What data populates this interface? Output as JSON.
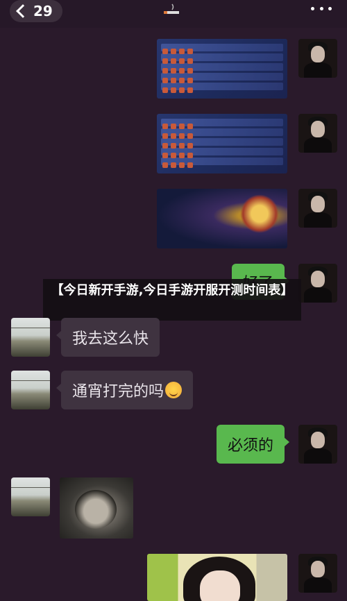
{
  "header": {
    "unread_count": "29",
    "back_icon": "chevron-left-icon",
    "more_icon": "more-dots-icon"
  },
  "banner": {
    "text": "【今日新开手游,今日手游开服开测时间表】"
  },
  "messages": [
    {
      "sender": "me",
      "type": "image",
      "description_icon": "game-ranking-screenshot"
    },
    {
      "sender": "me",
      "type": "image",
      "description_icon": "game-ranking-screenshot"
    },
    {
      "sender": "me",
      "type": "image",
      "description_icon": "game-hero-screenshot"
    },
    {
      "sender": "me",
      "type": "text",
      "text": "好了"
    },
    {
      "sender": "them",
      "type": "text",
      "text": "我去这么快"
    },
    {
      "sender": "them",
      "type": "text",
      "text": "通宵打完的吗"
    },
    {
      "sender": "me",
      "type": "text",
      "text": "必须的"
    },
    {
      "sender": "them",
      "type": "image",
      "description_icon": "photo"
    },
    {
      "sender": "me",
      "type": "image",
      "description_icon": "photo"
    }
  ],
  "colors": {
    "background": "#2a1a2b",
    "my_bubble": "#59b84e",
    "their_bubble": "#3f3340"
  }
}
